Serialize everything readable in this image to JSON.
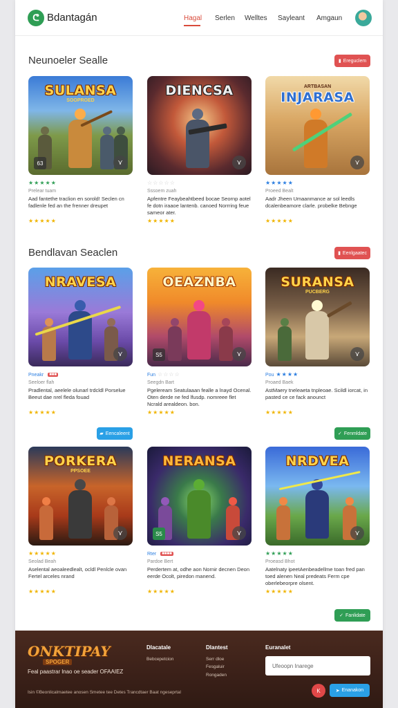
{
  "header": {
    "brand": "Bdantagán",
    "logo_glyph": "ᕦ",
    "nav": [
      {
        "label": "Hagal",
        "active": true
      },
      {
        "label": "Serlen",
        "active": false
      },
      {
        "label": "Welltes",
        "active": false
      },
      {
        "label": "Sayleant",
        "active": false
      },
      {
        "label": "Amgaun",
        "active": false
      }
    ]
  },
  "colors": {
    "accent": "#d94a3a",
    "green": "#2f9e55",
    "blue": "#2aa0e6",
    "red": "#e05252",
    "star": "#f0b400"
  },
  "sections": [
    {
      "title": "Neunoeler Sealle",
      "button": "Ereguclem",
      "cards": [
        {
          "game_title": "SULANSA",
          "game_sub": "SOOPROED",
          "rating_top": "★★★★★",
          "meta": "Prelear tuam",
          "desc": "Aad fantethe traclion en sorold! Seclen cn fadlenle fed an the frenner dreupet",
          "stars": "★★★★★",
          "corner_left": "63"
        },
        {
          "game_title": "DIENCSA",
          "game_sub": "",
          "rating_top": "☆☆☆☆☆",
          "meta": "Sssoem zuah",
          "desc": "Apfentre Feaybeahtbeed bocae Seornp aotel fe dotn iraaoe lantenb. canoed Norrring feue sameor ater.",
          "stars": "★★★★★",
          "corner_left": ""
        },
        {
          "game_title": "INJARASA",
          "game_sub": "ARTBASAN",
          "rating_top": "★★★★★",
          "meta": "Proeed Bealt",
          "desc": "Aadr Jheen Umaanmance ar sol leedls dcalenbeamore clarle. probelke Bebnge",
          "stars": "★★★★★",
          "corner_left": ""
        }
      ]
    },
    {
      "title": "Bendlavan Seaclen",
      "button": "Eenlgaatec",
      "cards": [
        {
          "game_title": "NRAVESA",
          "game_sub": "",
          "rating_top_label": "Pneakr",
          "rating_top_tag": "■■■",
          "meta": "Seeloer flah",
          "desc": "Pradlental, aeelele olunarl trdcldl Porselue Beeut dae nrel fleda fouad",
          "stars": "★★★★★",
          "corner_left": ""
        },
        {
          "game_title": "OEAZNBA",
          "game_sub": "",
          "rating_top_label": "Fun",
          "rating_top": "☆☆☆☆",
          "meta": "Seegdn Bart",
          "desc": "Pgeleream Seatulaaan fealle a lnayd Ocenal. Oten derde ne fed lfusdp. nomreee flet Ncrald arealdeon. bon.",
          "stars": "★★★★★",
          "corner_left": "S5"
        },
        {
          "game_title": "SURANSA",
          "game_sub": "PUCBERG",
          "rating_top_label": "Pou",
          "rating_top": "★★★★",
          "meta": "Proaed Baek",
          "desc": "AstMaery tneleaeta tnpleoae. Scildl iorcat, in pasted ce ce fack anounct",
          "stars": "★★★★★",
          "corner_left": ""
        }
      ]
    },
    {
      "title": "",
      "button_top": "Eencaleent",
      "button_right": "Fenmldate",
      "cards": [
        {
          "game_title": "PORKERA",
          "game_sub": "PPSOEE",
          "rating_top": "★★★★★",
          "meta": "Seolad Beah",
          "desc": "Aselental aeoaleedlealt, ocldl Penlcle ovan Fertel arceles nrand",
          "stars": "★★★★★",
          "corner_left": ""
        },
        {
          "game_title": "NERANSA",
          "game_sub": "",
          "rating_top_label": "Rter",
          "rating_top_tag": "■■■■",
          "meta": "Pardoe Bert",
          "desc": "Perdertem at, odhe aon Nornir decnen Deon eerde Ocolt, piredon manend.",
          "stars": "★★★★★",
          "corner_left": "S5"
        },
        {
          "game_title": "NRDVEA",
          "game_sub": "",
          "rating_top": "★★★★★",
          "meta": "Proeasd Bhot",
          "desc": "Aatelnaty ipeetAenbeadellme toan fred pan toed alenen Neal predeats Ferm cpe oberlebeorpre olsent.",
          "stars": "★★★★★",
          "corner_left": ""
        }
      ]
    }
  ],
  "load_more_label": "Fanlidate",
  "footer": {
    "logo": "ONKTIPAY",
    "logo_sub": "SPOGER",
    "tagline": "Feal paastrar lnao oe seader OFAAIEZ",
    "copyright": "Isin ©Beonlicalmaetee anosen Smetee tee Detes Trancdtaer Baat ngeseprtal",
    "columns": [
      {
        "title": "Dlacatale",
        "links": [
          "Bebcepetcion"
        ]
      },
      {
        "title": "Dlantest",
        "links": [
          "Serr dloe",
          "Fesgaluir",
          "Rongaden"
        ]
      },
      {
        "title": "Euranalet",
        "links": []
      }
    ],
    "newsletter_placeholder": "Ufeoopn Inarege",
    "round_btn": "K",
    "submit_label": "Enanakon"
  }
}
